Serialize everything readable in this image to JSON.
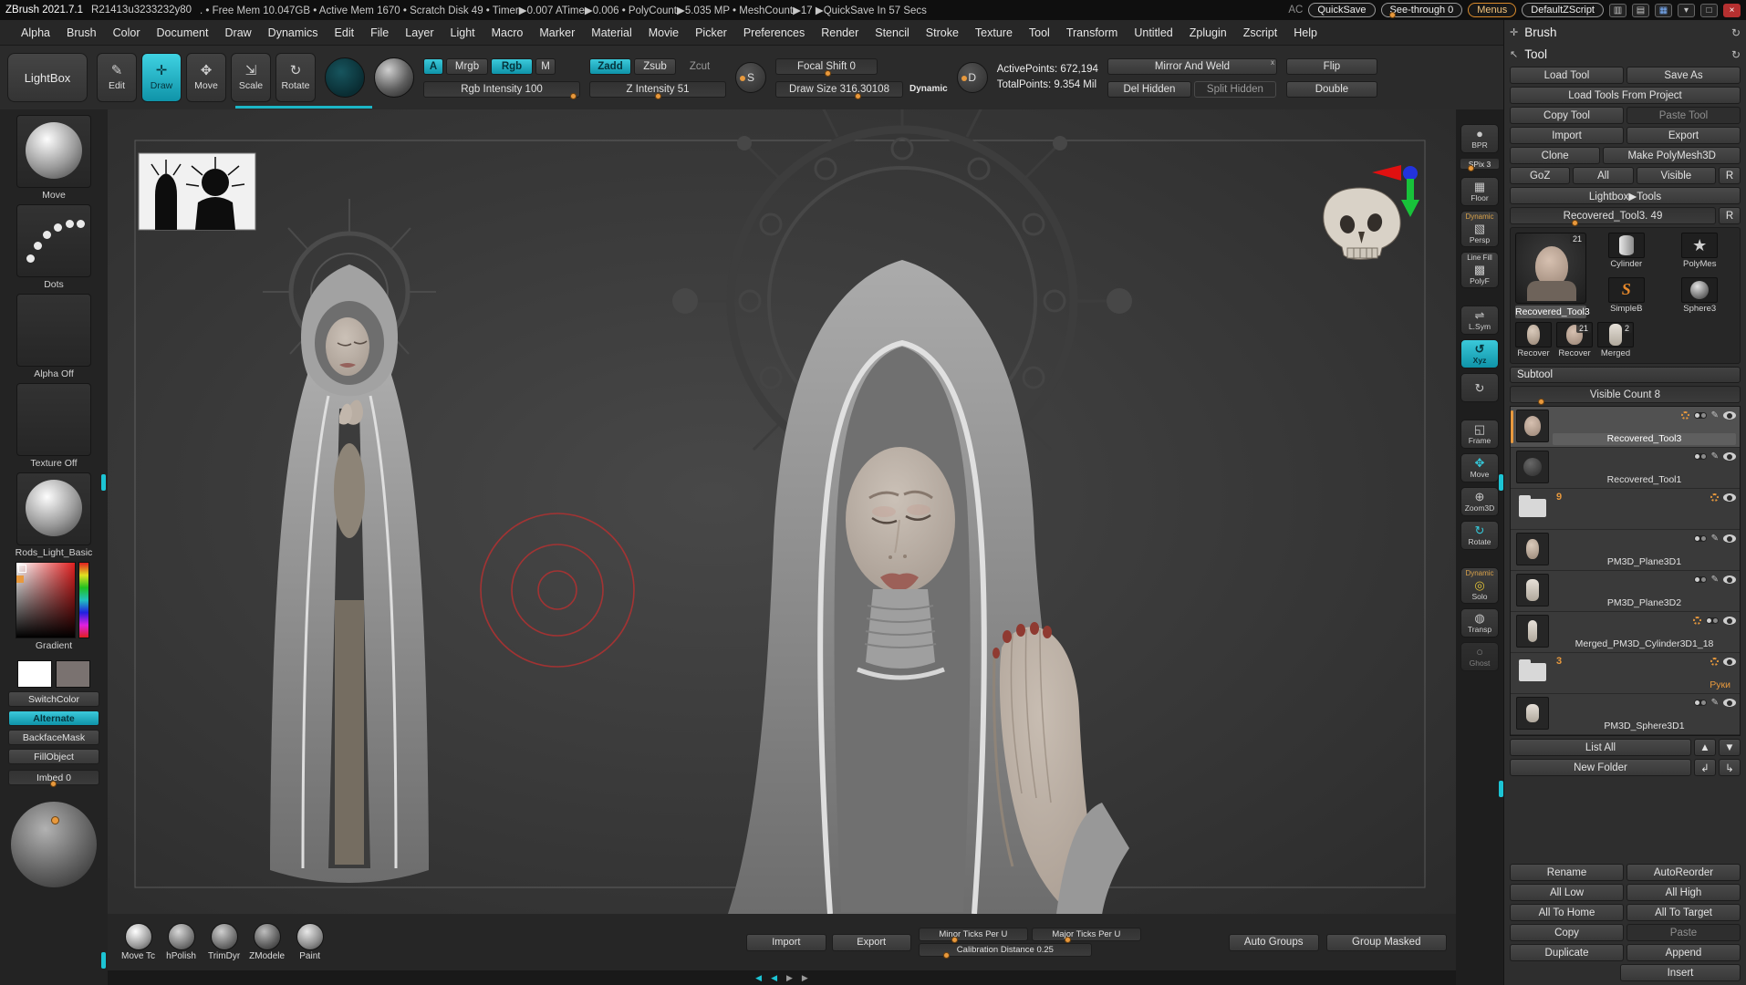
{
  "colors": {
    "accent": "#1cb6c6",
    "slider_dot": "#e8993d",
    "cursor_red": "#b43131"
  },
  "title_bar": {
    "app_title": "ZBrush 2021.7.1",
    "build": "R21413u3233232y80",
    "status": ". • Free Mem 10.047GB • Active Mem 1670 • Scratch Disk 49 • Timer▶0.007 ATime▶0.006 • PolyCount▶5.035 MP • MeshCount▶17  ▶QuickSave In 57 Secs",
    "ac": "AC",
    "quicksave": "QuickSave",
    "see_through": "See-through 0",
    "menus": "Menus",
    "zscript": "DefaultZScript"
  },
  "menu_bar": {
    "items": [
      "Alpha",
      "Brush",
      "Color",
      "Document",
      "Draw",
      "Dynamics",
      "Edit",
      "File",
      "Layer",
      "Light",
      "Macro",
      "Marker",
      "Material",
      "Movie",
      "Picker",
      "Preferences",
      "Render",
      "Stencil",
      "Stroke",
      "Texture",
      "Tool",
      "Transform",
      "Untitled",
      "Zplugin",
      "Zscript",
      "Help"
    ]
  },
  "dock": {
    "brush_header": "Brush",
    "tool_header": "Tool"
  },
  "shelf": {
    "lightbox": "LightBox",
    "edit": "Edit",
    "draw": "Draw",
    "move": "Move",
    "scale": "Scale",
    "rotate": "Rotate",
    "a": "A",
    "mrgb": "Mrgb",
    "rgb": "Rgb",
    "m": "M",
    "rgb_intensity": "Rgb Intensity 100",
    "zadd": "Zadd",
    "zsub": "Zsub",
    "zcut": "Zcut",
    "z_intensity": "Z Intensity 51",
    "focal_shift": "Focal Shift 0",
    "draw_size": "Draw Size 316.30108",
    "dynamic": "Dynamic",
    "active_points": "ActivePoints: 672,194",
    "total_points": "TotalPoints: 9.354 Mil",
    "mirror_and_weld": "Mirror And Weld",
    "mirror_sup": "x",
    "del_hidden": "Del Hidden",
    "split_hidden": "Split Hidden",
    "flip": "Flip",
    "double": "Double"
  },
  "left_panel": {
    "brush_name": "Move",
    "stroke_name": "Dots",
    "alpha_name": "Alpha Off",
    "texture_name": "Texture Off",
    "material_name": "Rods_Light_Basic",
    "gradient_label": "Gradient",
    "switch_color": "SwitchColor",
    "alternate": "Alternate",
    "backface_mask": "BackfaceMask",
    "fill_object": "FillObject",
    "imbed": "Imbed 0"
  },
  "right_strip": {
    "bpr": "BPR",
    "spix": "SPix 3",
    "floor": "Floor",
    "dynamic_label": "Dynamic",
    "persp": "Persp",
    "line_fill": "Line Fill",
    "polyf": "PolyF",
    "lsym": "L.Sym",
    "xyz": "Xyz",
    "frame": "Frame",
    "move": "Move",
    "zoom3d": "Zoom3D",
    "rotate": "Rotate",
    "dynamic2": "Dynamic",
    "solo": "Solo",
    "transp": "Transp",
    "ghost": "Ghost"
  },
  "tool_panel": {
    "load_tool": "Load Tool",
    "save_as": "Save As",
    "load_from_project": "Load Tools From Project",
    "copy_tool": "Copy Tool",
    "paste_tool": "Paste Tool",
    "import": "Import",
    "export": "Export",
    "clone": "Clone",
    "make_polymesh": "Make PolyMesh3D",
    "goz": "GoZ",
    "all": "All",
    "visible": "Visible",
    "r1": "R",
    "lightbox_tools": "Lightbox▶Tools",
    "active_tool_slider": "Recovered_Tool3. 49",
    "r2": "R",
    "thumbs": {
      "active_label": "Recovered_Tool3",
      "active_badge": "21",
      "cylinder": "Cylinder",
      "polymes": "PolyMes",
      "simpleb": "SimpleB",
      "sphere3": "Sphere3",
      "recover1": "Recover",
      "recover2": "Recover",
      "recover2_badge": "21",
      "merged": "Merged",
      "merged_badge": "2"
    }
  },
  "subtool": {
    "header": "Subtool",
    "visible_count": "Visible Count 8",
    "items": [
      {
        "name": "Recovered_Tool3"
      },
      {
        "name": "Recovered_Tool1"
      },
      {
        "name": "",
        "badge": "9"
      },
      {
        "name": "PM3D_Plane3D1"
      },
      {
        "name": "PM3D_Plane3D2"
      },
      {
        "name": "Merged_PM3D_Cylinder3D1_18"
      },
      {
        "name": "Руки",
        "badge": "3"
      },
      {
        "name": "PM3D_Sphere3D1"
      }
    ],
    "list_all": "List All",
    "new_folder": "New Folder",
    "rename": "Rename",
    "autoreorder": "AutoReorder",
    "all_low": "All Low",
    "all_high": "All High",
    "all_to_home": "All To Home",
    "all_to_target": "All To Target",
    "copy": "Copy",
    "paste": "Paste",
    "duplicate": "Duplicate",
    "append": "Append",
    "insert": "Insert"
  },
  "bottom_bar": {
    "brushes": [
      "Move Tc",
      "hPolish",
      "TrimDyr",
      "ZModele",
      "Paint"
    ],
    "import": "Import",
    "export": "Export",
    "minor_ticks": "Minor Ticks Per U",
    "major_ticks": "Major Ticks Per U",
    "calibration": "Calibration Distance 0.25",
    "auto_groups": "Auto Groups",
    "group_masked": "Group Masked"
  }
}
